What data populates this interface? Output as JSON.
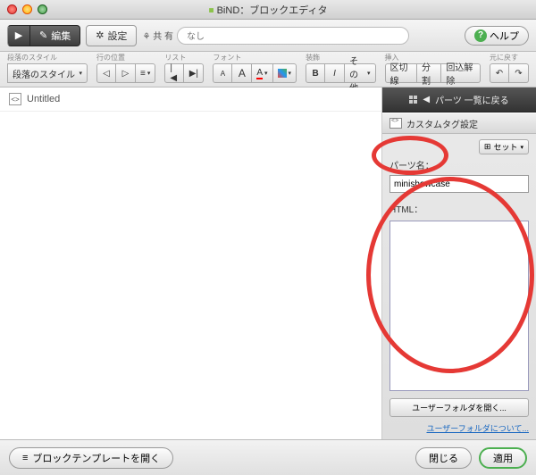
{
  "window": {
    "title": "BiND：ブロックエディタ"
  },
  "topbar": {
    "edit": "編集",
    "settings": "設定",
    "share_label": "共 有",
    "share_value": "なし",
    "help": "ヘルプ"
  },
  "toolbar": {
    "groups": {
      "style": {
        "label": "段落のスタイル",
        "button": "段落のスタイル"
      },
      "indent": {
        "label": "行の位置"
      },
      "list": {
        "label": "リスト"
      },
      "font": {
        "label": "フォント",
        "a1": "A",
        "a2": "A",
        "abtn": "A"
      },
      "decor": {
        "label": "装飾",
        "b": "B",
        "i": "I",
        "other": "その他"
      },
      "insert": {
        "label": "挿入",
        "sep": "区切線",
        "split": "分割",
        "clear": "回込解除"
      },
      "undo": {
        "label": "元に戻す"
      }
    }
  },
  "editor": {
    "tab_name": "Untitled"
  },
  "side": {
    "back": "パーツ 一覧に戻る",
    "panel_title": "カスタムタグ設定",
    "set_button": "セット",
    "part_name_label": "パーツ名：",
    "part_name_value": "minishowcase",
    "html_label": "HTML：",
    "user_folder_btn": "ユーザーフォルダを開く...",
    "user_folder_link": "ユーザーフォルダについて..."
  },
  "footer": {
    "template": "ブロックテンプレートを開く",
    "close": "閉じる",
    "apply": "適用"
  }
}
